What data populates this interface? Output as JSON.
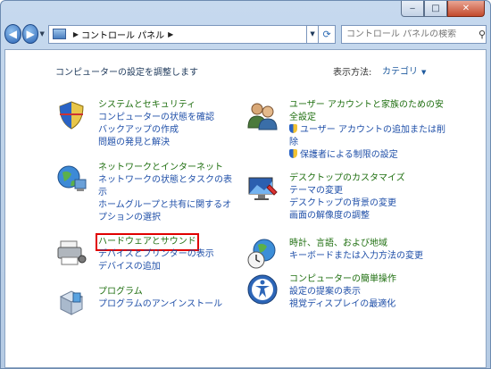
{
  "window": {
    "caption": {
      "minimize": "‒",
      "maximize": "□",
      "close": "✕"
    }
  },
  "toolbar": {
    "address_path": "コントロール パネル",
    "search_placeholder": "コントロール パネルの検索"
  },
  "main": {
    "heading": "コンピューターの設定を調整します",
    "view_label": "表示方法:",
    "view_value": "カテゴリ"
  },
  "categories": [
    {
      "title": "システムとセキュリティ",
      "links": [
        "コンピューターの状態を確認",
        "バックアップの作成",
        "問題の発見と解決"
      ]
    },
    {
      "title": "ネットワークとインターネット",
      "links": [
        "ネットワークの状態とタスクの表示",
        "ホームグループと共有に関するオプションの選択"
      ]
    },
    {
      "title": "ハードウェアとサウンド",
      "links": [
        "デバイスとプリンターの表示",
        "デバイスの追加"
      ]
    },
    {
      "title": "プログラム",
      "links": [
        "プログラムのアンインストール"
      ]
    },
    {
      "title": "ユーザー アカウントと家族のための安全設定",
      "links": [
        "ユーザー アカウントの追加または削除",
        "保護者による制限の設定"
      ]
    },
    {
      "title": "デスクトップのカスタマイズ",
      "links": [
        "テーマの変更",
        "デスクトップの背景の変更",
        "画面の解像度の調整"
      ]
    },
    {
      "title": "時計、言語、および地域",
      "links": [
        "キーボードまたは入力方法の変更"
      ]
    },
    {
      "title": "コンピューターの簡単操作",
      "links": [
        "設定の提案の表示",
        "視覚ディスプレイの最適化"
      ]
    }
  ],
  "colors": {
    "category_title": "#1f6f10",
    "link": "#1f4fa8",
    "highlight": "#e00000"
  }
}
